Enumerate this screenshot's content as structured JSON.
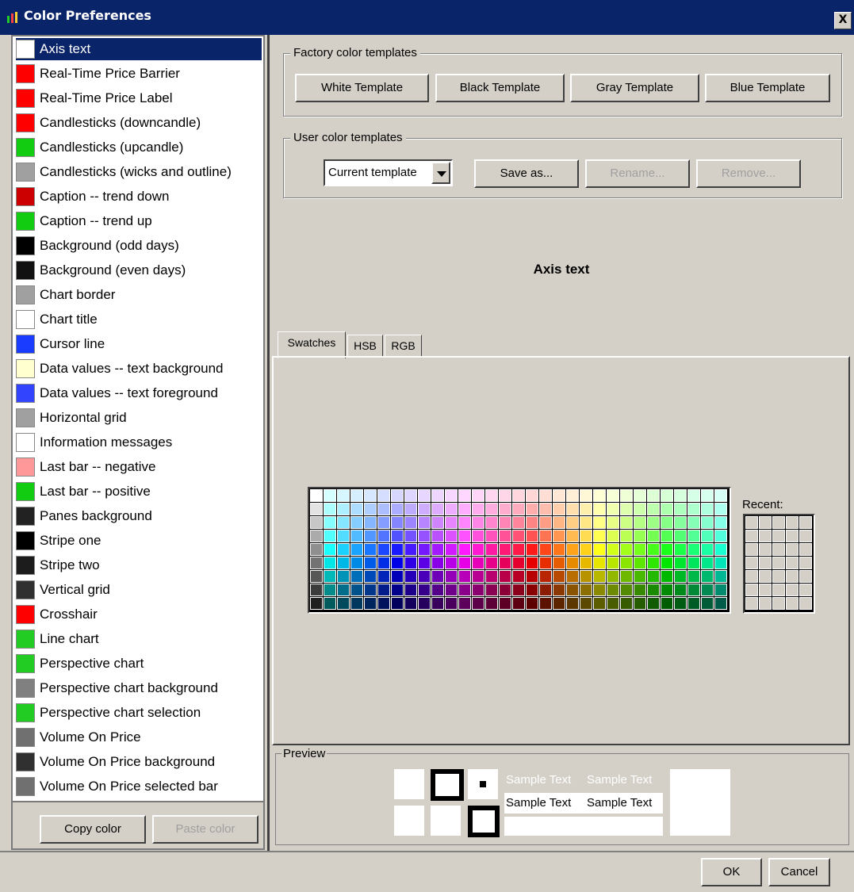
{
  "window": {
    "title": "Color Preferences",
    "close_glyph": "X"
  },
  "color_items": [
    {
      "label": "Axis text",
      "color": "#ffffff",
      "selected": true
    },
    {
      "label": "Real-Time Price Barrier",
      "color": "#ff0000"
    },
    {
      "label": "Real-Time Price Label",
      "color": "#ff0000"
    },
    {
      "label": "Candlesticks (downcandle)",
      "color": "#ff0000"
    },
    {
      "label": "Candlesticks (upcandle)",
      "color": "#11cc11"
    },
    {
      "label": "Candlesticks (wicks and outline)",
      "color": "#a0a0a0"
    },
    {
      "label": "Caption -- trend down",
      "color": "#cc0000"
    },
    {
      "label": "Caption -- trend up",
      "color": "#11cc11"
    },
    {
      "label": "Background (odd days)",
      "color": "#000000"
    },
    {
      "label": "Background (even days)",
      "color": "#111111"
    },
    {
      "label": "Chart border",
      "color": "#a0a0a0"
    },
    {
      "label": "Chart title",
      "color": "#ffffff"
    },
    {
      "label": "Cursor line",
      "color": "#1a3cff"
    },
    {
      "label": "Data values -- text background",
      "color": "#ffffd0"
    },
    {
      "label": "Data values -- text foreground",
      "color": "#3344ff"
    },
    {
      "label": "Horizontal grid",
      "color": "#a0a0a0"
    },
    {
      "label": "Information messages",
      "color": "#ffffff"
    },
    {
      "label": "Last bar -- negative",
      "color": "#ff9999"
    },
    {
      "label": "Last bar -- positive",
      "color": "#11cc11"
    },
    {
      "label": "Panes background",
      "color": "#222222"
    },
    {
      "label": "Stripe one",
      "color": "#000000"
    },
    {
      "label": "Stripe two",
      "color": "#1c1c1c"
    },
    {
      "label": "Vertical grid",
      "color": "#303030"
    },
    {
      "label": "Crosshair",
      "color": "#ff0000"
    },
    {
      "label": "Line chart",
      "color": "#22cc22"
    },
    {
      "label": "Perspective chart",
      "color": "#22cc22"
    },
    {
      "label": "Perspective chart background",
      "color": "#808080"
    },
    {
      "label": "Perspective chart selection",
      "color": "#22cc22"
    },
    {
      "label": "Volume On Price",
      "color": "#707070"
    },
    {
      "label": "Volume On Price background",
      "color": "#303030"
    },
    {
      "label": "Volume On Price selected bar",
      "color": "#707070"
    }
  ],
  "left_buttons": {
    "copy": "Copy color",
    "paste": "Paste color"
  },
  "factory": {
    "legend": "Factory color templates",
    "buttons": [
      "White Template",
      "Black Template",
      "Gray Template",
      "Blue Template"
    ]
  },
  "user": {
    "legend": "User color templates",
    "combo_value": "Current template",
    "save": "Save as...",
    "rename": "Rename...",
    "remove": "Remove..."
  },
  "selected_title": "Axis text",
  "tabs": {
    "swatches": "Swatches",
    "hsb": "HSB",
    "rgb": "RGB"
  },
  "recent_label": "Recent:",
  "preview": {
    "legend": "Preview",
    "sample_text": "Sample Text"
  },
  "footer": {
    "ok": "OK",
    "cancel": "Cancel"
  }
}
